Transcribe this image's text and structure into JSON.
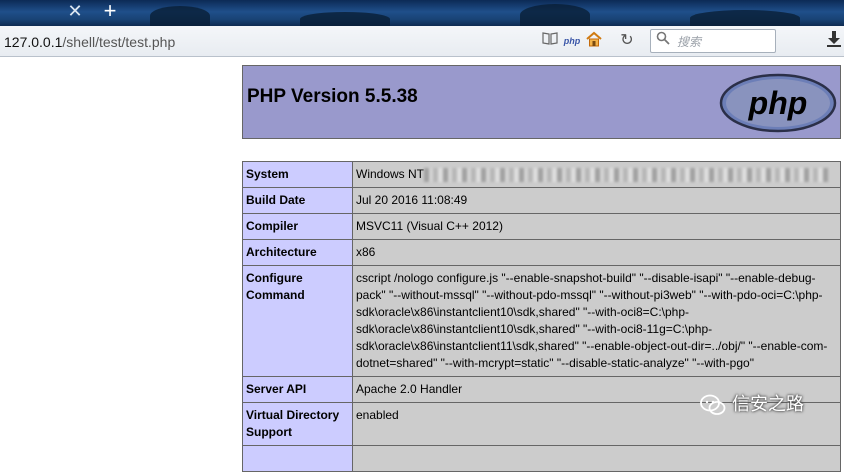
{
  "browser": {
    "tab_close_glyph": "✕",
    "tab_new_glyph": "+",
    "address_host": "127.0.0.1",
    "address_path": "/shell/test/test.php",
    "toolbar_icons": [
      "reader-icon",
      "php-icon",
      "home-icon",
      "refresh-icon"
    ],
    "php_badge": "php",
    "search_placeholder": "搜索"
  },
  "phpinfo": {
    "title": "PHP Version 5.5.38",
    "logo_text": "php",
    "rows": [
      {
        "key": "System",
        "value": "Windows NT"
      },
      {
        "key": "Build Date",
        "value": "Jul 20 2016 11:08:49"
      },
      {
        "key": "Compiler",
        "value": "MSVC11 (Visual C++ 2012)"
      },
      {
        "key": "Architecture",
        "value": "x86"
      },
      {
        "key": "Configure Command",
        "value": "cscript /nologo configure.js \"--enable-snapshot-build\" \"--disable-isapi\" \"--enable-debug-pack\" \"--without-mssql\" \"--without-pdo-mssql\" \"--without-pi3web\" \"--with-pdo-oci=C:\\php-sdk\\oracle\\x86\\instantclient10\\sdk,shared\" \"--with-oci8=C:\\php-sdk\\oracle\\x86\\instantclient10\\sdk,shared\" \"--with-oci8-11g=C:\\php-sdk\\oracle\\x86\\instantclient11\\sdk,shared\" \"--enable-object-out-dir=../obj/\" \"--enable-com-dotnet=shared\" \"--with-mcrypt=static\" \"--disable-static-analyze\" \"--with-pgo\""
      },
      {
        "key": "Server API",
        "value": "Apache 2.0 Handler"
      },
      {
        "key": "Virtual Directory Support",
        "value": "enabled"
      }
    ]
  },
  "watermark": {
    "text": "信安之路"
  },
  "colors": {
    "header_bg": "#9999cc",
    "key_bg": "#ccccff",
    "value_bg": "#cccccc",
    "logo_text": "#000000"
  }
}
